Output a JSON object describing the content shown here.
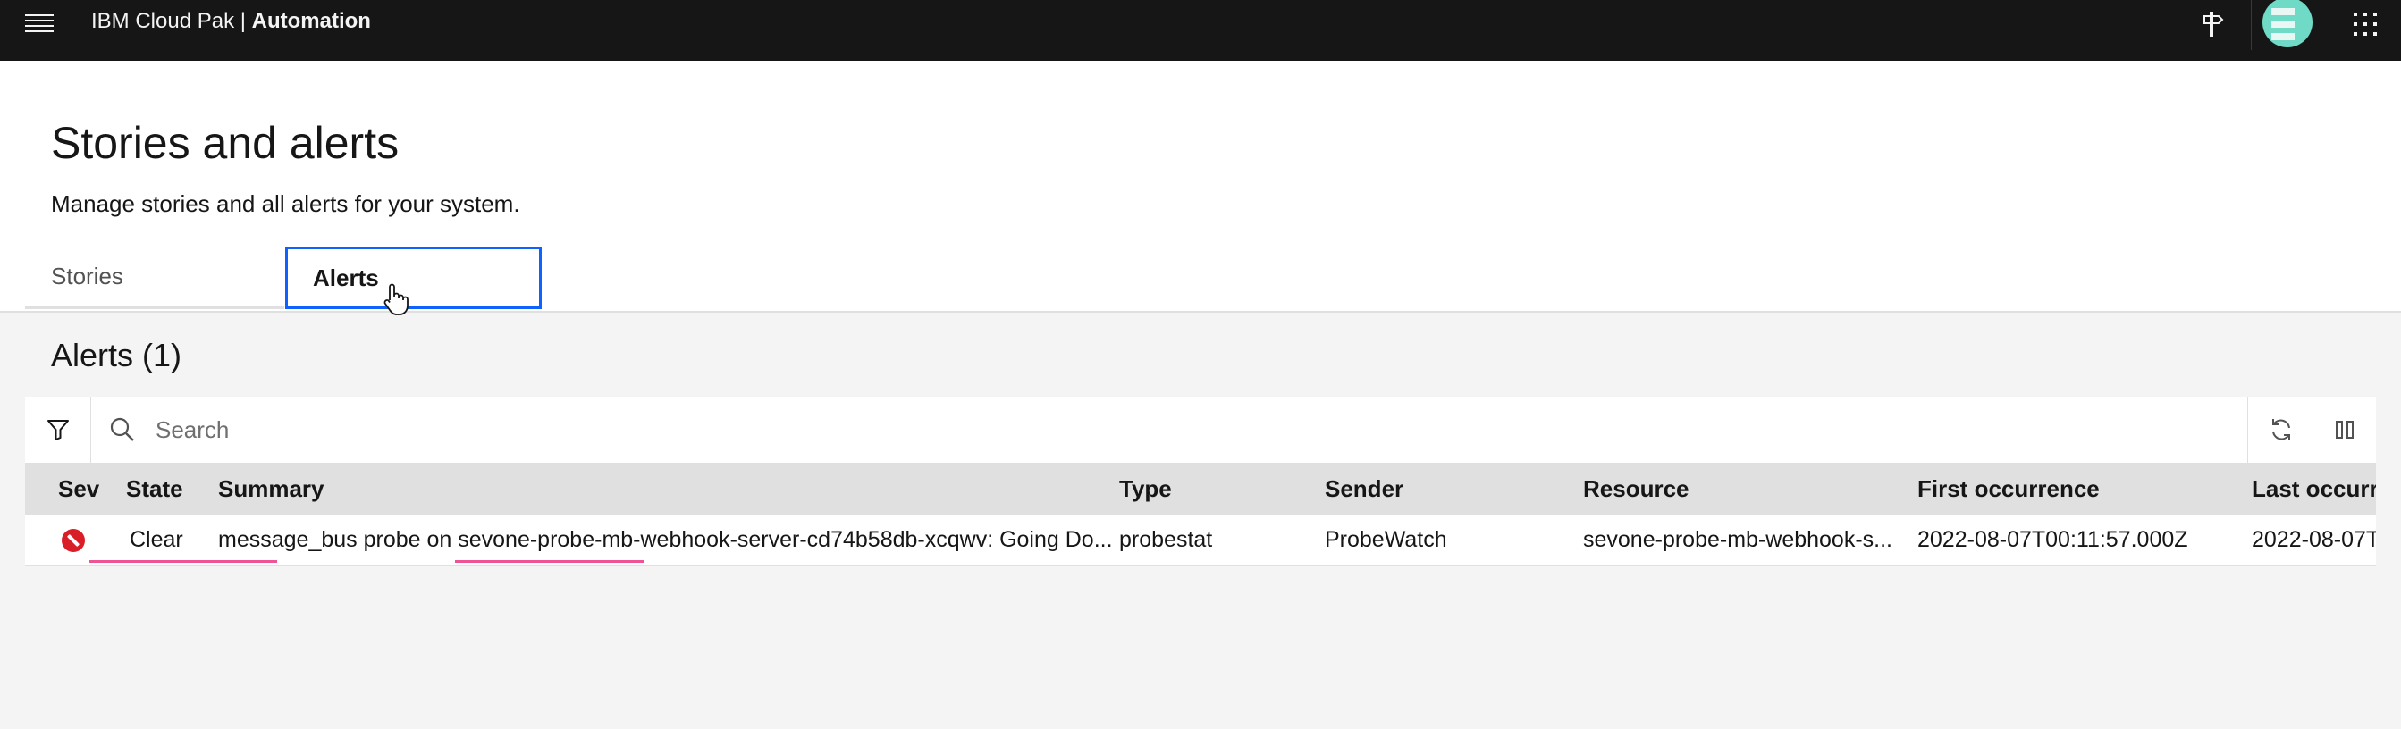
{
  "topbar": {
    "brand_prefix": "IBM Cloud Pak | ",
    "brand_product": "Automation",
    "icons": [
      "menu-icon",
      "signpost-icon",
      "avatar",
      "app-switcher-icon"
    ]
  },
  "page": {
    "title": "Stories and alerts",
    "subtitle": "Manage stories and all alerts for your system."
  },
  "tabs": [
    {
      "label": "Stories",
      "selected": false
    },
    {
      "label": "Alerts",
      "selected": true
    }
  ],
  "alerts": {
    "heading": "Alerts (1)",
    "search_placeholder": "Search",
    "columns": [
      "Sev",
      "State",
      "Summary",
      "Type",
      "Sender",
      "Resource",
      "First occurrence",
      "Last occurre"
    ],
    "rows": [
      {
        "severity": "critical-icon",
        "state": "Clear",
        "summary": "message_bus probe on sevone-probe-mb-webhook-server-cd74b58db-xcqwv: Going Do...",
        "type": "probestat",
        "sender": "ProbeWatch",
        "resource": "sevone-probe-mb-webhook-s...",
        "first_occurrence": "2022-08-07T00:11:57.000Z",
        "last_occurrence": "2022-08-07T"
      }
    ]
  },
  "colors": {
    "topbar_bg": "#161616",
    "tab_focus": "#0f62fe",
    "severity_critical": "#da1e28",
    "annotation_underline": "#ee5396"
  }
}
